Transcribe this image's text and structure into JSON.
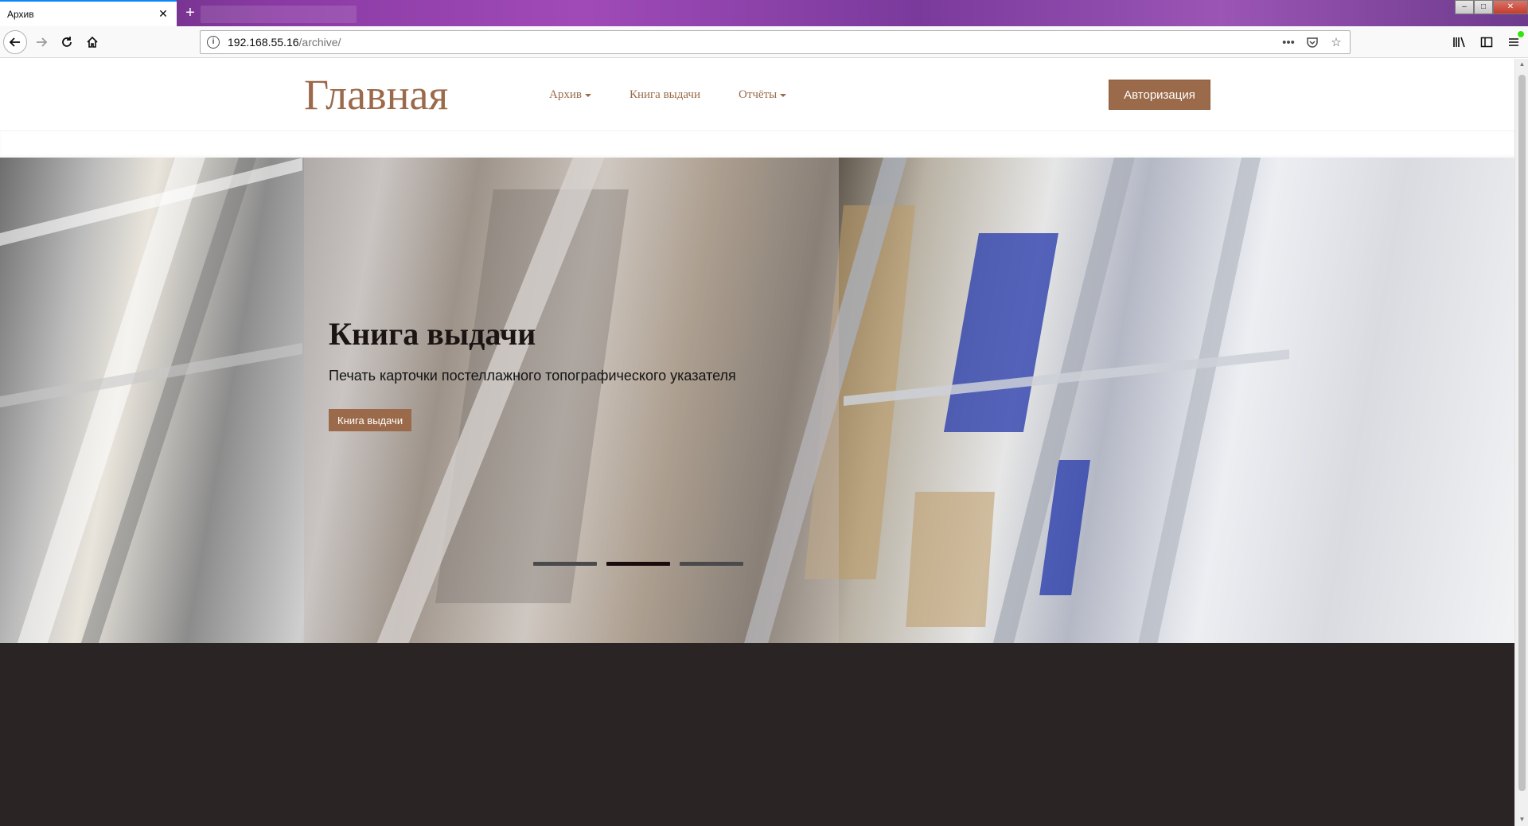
{
  "browser": {
    "tab_title": "Архив",
    "tab_close": "✕",
    "new_tab": "+",
    "url_host": "192.168.55.16",
    "url_path": "/archive/",
    "win_min": "–",
    "win_max": "□",
    "win_close": "✕"
  },
  "site": {
    "brand": "Главная",
    "menu": [
      {
        "label": "Архив",
        "has_dropdown": true
      },
      {
        "label": "Книга выдачи",
        "has_dropdown": false
      },
      {
        "label": "Отчёты",
        "has_dropdown": true
      }
    ],
    "auth_button": "Авторизация"
  },
  "hero": {
    "title": "Книга выдачи",
    "subtitle": "Печать карточки постеллажного топографического указателя",
    "button": "Книга выдачи",
    "slides_total": 3,
    "active_slide": 2
  },
  "colors": {
    "accent": "#9b6a4a",
    "footer": "#2b2425"
  }
}
